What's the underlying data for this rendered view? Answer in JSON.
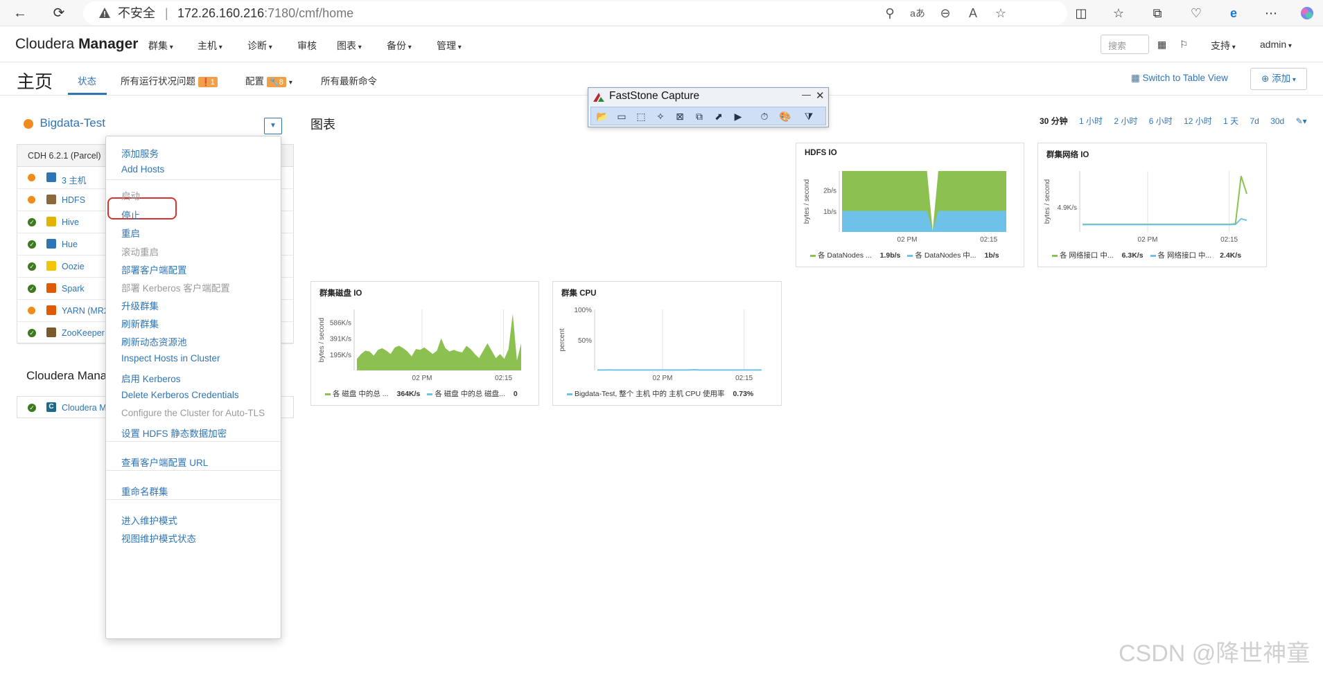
{
  "browser": {
    "insecure_label": "不安全",
    "url_host": "172.26.160.216",
    "url_path": ":7180/cmf/home",
    "back_icon": "←",
    "refresh_icon": "⟳",
    "toolbar_icons": [
      "⚲",
      "aあ",
      "⊖",
      "A",
      "☆",
      "◫",
      "☆",
      "⧉",
      "♡",
      "e",
      "⋯"
    ]
  },
  "nav": {
    "brand_light": "Cloudera ",
    "brand_bold": "Manager",
    "items": [
      "群集",
      "主机",
      "诊断",
      "审核",
      "图表",
      "备份",
      "管理"
    ],
    "search_placeholder": "搜索",
    "support": "支持",
    "user": "admin"
  },
  "header": {
    "title": "主页",
    "tabs": {
      "status": "状态",
      "health_issues": "所有运行状况问题",
      "health_badge": "1",
      "config": "配置",
      "config_badge": "8",
      "commands": "所有最新命令"
    },
    "table_view": "Switch to Table View",
    "add": "添加"
  },
  "cluster": {
    "name": "Bigdata-Test",
    "version": "CDH 6.2.1 (Parcel)",
    "services": [
      {
        "name": "3 主机",
        "status": "warn",
        "icon_color": "#2f75b5"
      },
      {
        "name": "HDFS",
        "status": "warn",
        "icon_color": "#8a6a3a"
      },
      {
        "name": "Hive",
        "status": "ok",
        "icon_color": "#e2b400"
      },
      {
        "name": "Hue",
        "status": "ok",
        "icon_color": "#2f75b5"
      },
      {
        "name": "Oozie",
        "status": "ok",
        "icon_color": "#f3c500"
      },
      {
        "name": "Spark",
        "status": "ok",
        "icon_color": "#e05a00"
      },
      {
        "name": "YARN (MR2",
        "status": "warn",
        "icon_color": "#e05a00"
      },
      {
        "name": "ZooKeeper",
        "status": "ok",
        "icon_color": "#7a5a2a"
      }
    ],
    "cm_title": "Cloudera Mana",
    "cm_row": "Cloudera M"
  },
  "menu": {
    "items": [
      {
        "label": "添加服务",
        "enabled": true
      },
      {
        "label": "Add Hosts",
        "enabled": true
      },
      {
        "label": "启动",
        "enabled": false
      },
      {
        "label": "停止",
        "enabled": true
      },
      {
        "label": "重启",
        "enabled": true
      },
      {
        "label": "滚动重启",
        "enabled": false
      },
      {
        "label": "部署客户端配置",
        "enabled": true
      },
      {
        "label": "部署 Kerberos 客户端配置",
        "enabled": false
      },
      {
        "label": "升级群集",
        "enabled": true
      },
      {
        "label": "刷新群集",
        "enabled": true
      },
      {
        "label": "刷新动态资源池",
        "enabled": true
      },
      {
        "label": "Inspect Hosts in Cluster",
        "enabled": true
      },
      {
        "label": "启用 Kerberos",
        "enabled": true
      },
      {
        "label": "Delete Kerberos Credentials",
        "enabled": true
      },
      {
        "label": "Configure the Cluster for Auto-TLS",
        "enabled": false
      },
      {
        "label": "设置 HDFS 静态数据加密",
        "enabled": true
      },
      {
        "label": "查看客户端配置 URL",
        "enabled": true
      },
      {
        "label": "重命名群集",
        "enabled": true
      },
      {
        "label": "进入维护模式",
        "enabled": true
      },
      {
        "label": "视图维护模式状态",
        "enabled": true
      }
    ]
  },
  "charts_section": {
    "title": "图表",
    "ranges": [
      "30 分钟",
      "1 小时",
      "2 小时",
      "6 小时",
      "12 小时",
      "1 天",
      "7d",
      "30d"
    ],
    "selected_range": "30 分钟"
  },
  "chart_data": [
    {
      "type": "area",
      "title": "HDFS IO",
      "ylabel": "bytes / second",
      "yticks": [
        "1b/s",
        "2b/s"
      ],
      "xticks": [
        "02 PM",
        "02:15"
      ],
      "ylim": [
        0,
        2.9
      ],
      "x": [
        0,
        1,
        2,
        3,
        4,
        5,
        6,
        7,
        8,
        9,
        10,
        11,
        12,
        13,
        14,
        15,
        16,
        17,
        18,
        19,
        20,
        21,
        22,
        23,
        24,
        25,
        26,
        27,
        28,
        29
      ],
      "series": [
        {
          "name": "各 DataNodes ...",
          "color": "#8cc152",
          "values": [
            2.9,
            2.9,
            2.9,
            2.9,
            2.9,
            2.9,
            2.9,
            2.9,
            2.9,
            2.9,
            2.9,
            2.9,
            2.9,
            2.9,
            2.9,
            2.9,
            0.05,
            2.9,
            2.9,
            2.9,
            2.9,
            2.9,
            2.9,
            2.9,
            2.9,
            2.9,
            2.9,
            2.9,
            2.9,
            2.9
          ]
        },
        {
          "name": "各 DataNodes 中...",
          "color": "#6ec2ea",
          "values": [
            1,
            1,
            1,
            1,
            1,
            1,
            1,
            1,
            1,
            1,
            1,
            1,
            1,
            1,
            1,
            1,
            0.05,
            1,
            1,
            1,
            1,
            1,
            1,
            1,
            1,
            1,
            1,
            1,
            1,
            1
          ]
        }
      ],
      "legend_values": [
        "1.9b/s",
        "1b/s"
      ]
    },
    {
      "type": "line",
      "title": "群集网络 IO",
      "ylabel": "bytes / second",
      "yticks": [
        "4.9K/s"
      ],
      "xticks": [
        "02 PM",
        "02:15"
      ],
      "ylim": [
        0,
        12000
      ],
      "x": [
        0,
        1,
        2,
        3,
        4,
        5,
        6,
        7,
        8,
        9,
        10,
        11,
        12,
        13,
        14,
        15,
        16,
        17,
        18,
        19,
        20,
        21,
        22,
        23,
        24,
        25,
        26,
        27,
        28,
        29
      ],
      "series": [
        {
          "name": "各 网络接口 中...",
          "color": "#8cc152",
          "values": [
            1500,
            1500,
            1500,
            1500,
            1500,
            1500,
            1500,
            1500,
            1500,
            1500,
            1500,
            1500,
            1500,
            1500,
            1500,
            1500,
            1500,
            1500,
            1500,
            1500,
            1500,
            1500,
            1500,
            1500,
            1500,
            1500,
            1500,
            1600,
            11000,
            7500
          ]
        },
        {
          "name": "各 网络接口 中...",
          "color": "#6ec2ea",
          "values": [
            1450,
            1450,
            1450,
            1450,
            1450,
            1450,
            1450,
            1450,
            1450,
            1450,
            1450,
            1450,
            1450,
            1450,
            1450,
            1450,
            1450,
            1450,
            1450,
            1450,
            1450,
            1450,
            1450,
            1450,
            1450,
            1450,
            1450,
            1480,
            2600,
            2300
          ]
        }
      ],
      "legend_values": [
        "6.3K/s",
        "2.4K/s"
      ]
    },
    {
      "type": "area",
      "title": "群集磁盘 IO",
      "ylabel": "bytes / second",
      "yticks": [
        "195K/s",
        "391K/s",
        "586K/s"
      ],
      "xticks": [
        "02 PM",
        "02:15"
      ],
      "ylim": [
        0,
        740
      ],
      "x": [
        0,
        1,
        2,
        3,
        4,
        5,
        6,
        7,
        8,
        9,
        10,
        11,
        12,
        13,
        14,
        15,
        16,
        17,
        18,
        19,
        20,
        21,
        22,
        23,
        24,
        25,
        26,
        27,
        28,
        29,
        30,
        31,
        32,
        33,
        34,
        35,
        36,
        37,
        38,
        39
      ],
      "series": [
        {
          "name": "各 磁盘 中的总 ...",
          "color": "#8cc152",
          "values": [
            140,
            200,
            240,
            230,
            180,
            250,
            270,
            240,
            200,
            280,
            300,
            270,
            230,
            170,
            260,
            250,
            280,
            240,
            200,
            240,
            390,
            270,
            230,
            250,
            230,
            220,
            300,
            260,
            200,
            150,
            240,
            330,
            240,
            150,
            200,
            140,
            260,
            690,
            120,
            330
          ]
        },
        {
          "name": "各 磁盘 中的总 磁盘...",
          "color": "#6ec2ea",
          "values": [
            0,
            0,
            0,
            0,
            0,
            0,
            0,
            0,
            0,
            0,
            0,
            0,
            0,
            0,
            0,
            0,
            0,
            0,
            0,
            0,
            0,
            0,
            0,
            0,
            0,
            0,
            0,
            0,
            0,
            0,
            0,
            0,
            0,
            0,
            0,
            0,
            0,
            0,
            0,
            0
          ]
        }
      ],
      "legend_values": [
        "364K/s",
        "0"
      ]
    },
    {
      "type": "line",
      "title": "群集 CPU",
      "ylabel": "percent",
      "yticks": [
        "50%",
        "100%"
      ],
      "xticks": [
        "02 PM",
        "02:15"
      ],
      "ylim": [
        0,
        100
      ],
      "x": [
        0,
        1,
        2,
        3,
        4,
        5,
        6,
        7,
        8,
        9,
        10,
        11,
        12,
        13,
        14,
        15,
        16,
        17,
        18,
        19,
        20,
        21,
        22,
        23,
        24,
        25,
        26,
        27,
        28,
        29
      ],
      "series": [
        {
          "name": "Bigdata-Test, 整个 主机 中的 主机 CPU 使用率",
          "color": "#6ec2ea",
          "values": [
            0.7,
            0.7,
            0.8,
            0.7,
            0.7,
            0.7,
            0.7,
            0.7,
            0.7,
            0.7,
            0.7,
            0.7,
            0.7,
            0.7,
            0.7,
            0.7,
            0.7,
            1.2,
            0.7,
            0.7,
            0.7,
            0.7,
            0.7,
            0.7,
            0.7,
            0.7,
            0.7,
            0.7,
            0.7,
            0.73
          ]
        }
      ],
      "legend_values": [
        "0.73%"
      ]
    }
  ],
  "faststone": {
    "title": "FastStone Capture",
    "minimize": "—",
    "close": "✕",
    "tools": [
      "📂",
      "▭",
      "⬚",
      "✧",
      "⊠",
      "⧉",
      "⬈",
      "▶",
      "⏱",
      "🎨",
      "⧩"
    ]
  },
  "watermark": "CSDN @降世神童"
}
